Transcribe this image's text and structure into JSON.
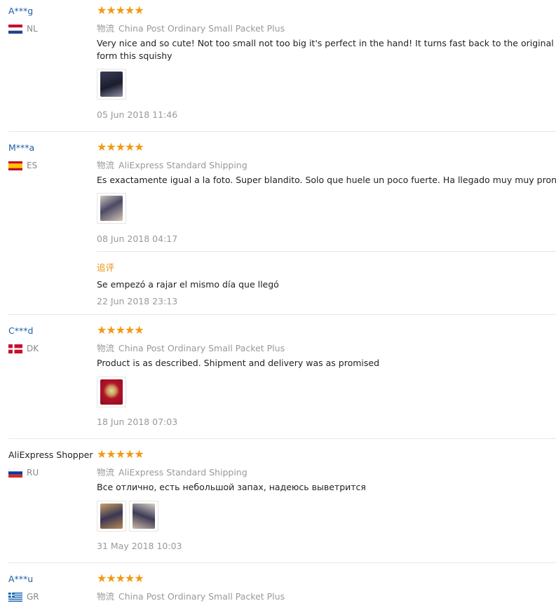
{
  "reviews": [
    {
      "user": "A***g",
      "country": "NL",
      "stars": 5,
      "logistics_label": "物流",
      "logistics": "China Post Ordinary Small Packet Plus",
      "text": "Very nice and so cute! Not too small not too big it's perfect in the hand! It turns fast back to the original form this squishy",
      "date": "05 Jun 2018 11:46"
    },
    {
      "user": "M***a",
      "country": "ES",
      "stars": 5,
      "logistics_label": "物流",
      "logistics": "AliExpress Standard Shipping",
      "text": "Es exactamente igual a la foto. Super blandito. Solo que huele un poco fuerte. Ha llegado muy muy pronto. R",
      "date": "08 Jun 2018 04:17",
      "followup_label": "追评",
      "followup_text": "Se empezó a rajar el mismo día que llegó",
      "followup_date": "22 Jun 2018 23:13"
    },
    {
      "user": "C***d",
      "country": "DK",
      "stars": 5,
      "logistics_label": "物流",
      "logistics": "China Post Ordinary Small Packet Plus",
      "text": "Product is as described. Shipment and delivery was as promised",
      "date": "18 Jun 2018 07:03"
    },
    {
      "user": "AliExpress Shopper",
      "country": "RU",
      "stars": 5,
      "logistics_label": "物流",
      "logistics": "AliExpress Standard Shipping",
      "text": "Все отлично, есть небольшой запах, надеюсь выветрится",
      "date": "31 May 2018 10:03"
    },
    {
      "user": "A***u",
      "country": "GR",
      "stars": 5,
      "logistics_label": "物流",
      "logistics": "China Post Ordinary Small Packet Plus"
    }
  ],
  "colors": {
    "star": "#f19a12",
    "username": "#1f5fa8",
    "followup": "#e89311"
  }
}
